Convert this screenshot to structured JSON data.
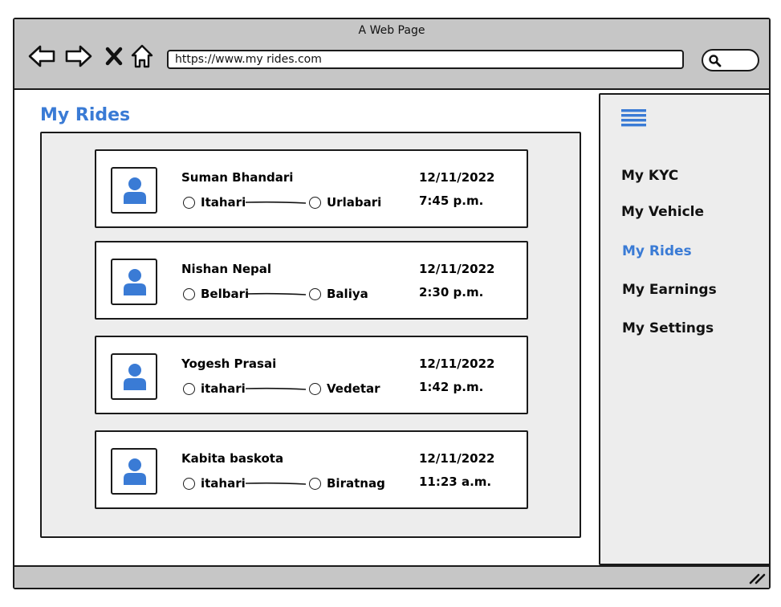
{
  "window": {
    "title": "A Web Page"
  },
  "toolbar": {
    "url": "https://www.my rides.com",
    "icons": [
      "back-arrow-icon",
      "forward-arrow-icon",
      "close-x-icon",
      "home-icon",
      "search-icon"
    ]
  },
  "main": {
    "title": "My Rides",
    "rides": [
      {
        "name": "Suman Bhandari",
        "from": "Itahari",
        "to": "Urlabari",
        "date": "12/11/2022",
        "time": "7:45 p.m."
      },
      {
        "name": "Nishan Nepal",
        "from": "Belbari",
        "to": "Baliya",
        "date": "12/11/2022",
        "time": "2:30 p.m."
      },
      {
        "name": "Yogesh Prasai",
        "from": "itahari",
        "to": "Vedetar",
        "date": "12/11/2022",
        "time": "1:42 p.m."
      },
      {
        "name": "Kabita baskota",
        "from": "itahari",
        "to": "Biratnag",
        "date": "12/11/2022",
        "time": "11:23 a.m."
      }
    ]
  },
  "sidebar": {
    "menu_icon": "hamburger-menu-icon",
    "items": [
      {
        "label": "My KYC",
        "active": false
      },
      {
        "label": "My Vehicle",
        "active": false
      },
      {
        "label": "My Rides",
        "active": true
      },
      {
        "label": "My Earnings",
        "active": false
      },
      {
        "label": "My Settings",
        "active": false
      }
    ]
  },
  "colors": {
    "accent": "#3a7bd5",
    "chrome": "#c6c6c6",
    "panel": "#ededed",
    "border": "#1a1a1a"
  }
}
